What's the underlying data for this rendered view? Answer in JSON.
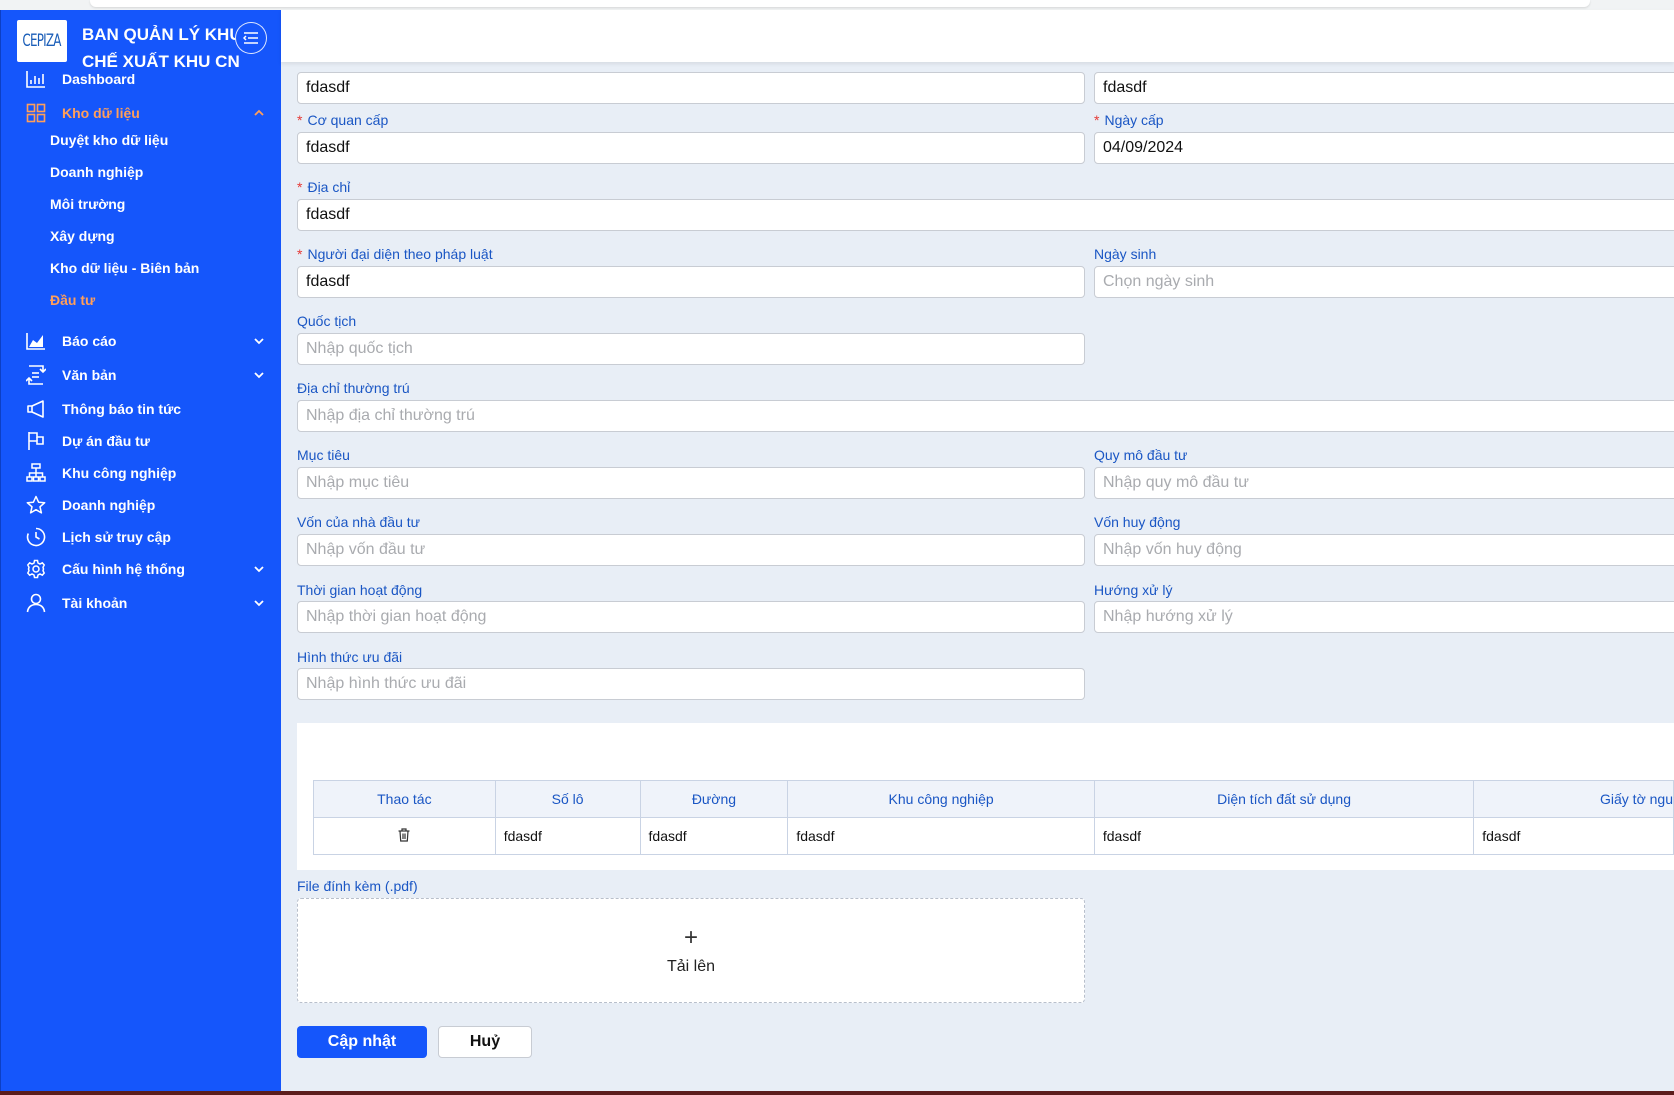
{
  "brand": {
    "logo_text": "CEPIZA",
    "line1": "BAN QUẢN LÝ KHU",
    "line2": "CHẾ XUẤT KHU CN"
  },
  "sidebar": {
    "items": [
      {
        "label": "Dashboard",
        "icon": "bar-chart-icon"
      },
      {
        "label": "Kho dữ liệu",
        "icon": "grid-icon",
        "active": true,
        "expanded": true
      },
      {
        "label": "Báo cáo",
        "icon": "area-chart-icon"
      },
      {
        "label": "Văn bản",
        "icon": "transfer-icon"
      },
      {
        "label": "Thông báo tin tức",
        "icon": "megaphone-icon"
      },
      {
        "label": "Dự án đầu tư",
        "icon": "flag-icon"
      },
      {
        "label": "Khu công nghiệp",
        "icon": "cluster-icon"
      },
      {
        "label": "Doanh nghiệp",
        "icon": "star-icon"
      },
      {
        "label": "Lịch sử truy cập",
        "icon": "clock-icon"
      },
      {
        "label": "Cấu hình hệ thống",
        "icon": "gear-icon"
      },
      {
        "label": "Tài khoản",
        "icon": "user-icon"
      }
    ],
    "subitems": [
      {
        "label": "Duyệt kho dữ liệu"
      },
      {
        "label": "Doanh nghiệp"
      },
      {
        "label": "Môi trường"
      },
      {
        "label": "Xây dựng"
      },
      {
        "label": "Kho dữ liệu - Biên bản"
      },
      {
        "label": "Đầu tư",
        "active": true
      }
    ]
  },
  "form": {
    "nha_dau_tu": {
      "value": "fdasdf"
    },
    "gcn": {
      "value": "fdasdf"
    },
    "co_quan_cap": {
      "label": "Cơ quan cấp",
      "value": "fdasdf"
    },
    "ngay_cap": {
      "label": "Ngày cấp",
      "value": "04/09/2024"
    },
    "dia_chi": {
      "label": "Địa chỉ",
      "value": "fdasdf"
    },
    "nguoi_dai_dien": {
      "label": "Người đại diện theo pháp luật",
      "value": "fdasdf"
    },
    "ngay_sinh": {
      "label": "Ngày sinh",
      "placeholder": "Chọn ngày sinh"
    },
    "quoc_tich": {
      "label": "Quốc tịch",
      "placeholder": "Nhập quốc tịch"
    },
    "dia_chi_thuong_tru": {
      "label": "Địa chỉ thường trú",
      "placeholder": "Nhập địa chỉ thường trú"
    },
    "muc_tieu": {
      "label": "Mục tiêu",
      "placeholder": "Nhập mục tiêu"
    },
    "quy_mo": {
      "label": "Quy mô đầu tư",
      "placeholder": "Nhập quy mô đầu tư"
    },
    "von_nha_dau_tu": {
      "label": "Vốn của nhà đầu tư",
      "placeholder": "Nhập vốn đầu tư"
    },
    "von_huy_dong": {
      "label": "Vốn huy động",
      "placeholder": "Nhập vốn huy động"
    },
    "thoi_gian": {
      "label": "Thời gian hoạt động",
      "placeholder": "Nhập thời gian hoạt động"
    },
    "huong_xu_ly": {
      "label": "Hướng xử lý",
      "placeholder": "Nhập hướng xử lý"
    },
    "hinh_thuc": {
      "label": "Hình thức ưu đãi",
      "placeholder": "Nhập hình thức ưu đãi"
    }
  },
  "table": {
    "headers": [
      "Thao tác",
      "Số lô",
      "Đường",
      "Khu công nghiệp",
      "Diện tích đất sử dụng",
      "Giấy tờ ngu"
    ],
    "rows": [
      {
        "action_icon": "trash-icon",
        "cells": [
          "fdasdf",
          "fdasdf",
          "fdasdf",
          "fdasdf",
          "fdasdf"
        ]
      }
    ]
  },
  "upload": {
    "label": "File đính kèm (.pdf)",
    "plus": "+",
    "button": "Tải lên"
  },
  "actions": {
    "submit": "Cập nhật",
    "cancel": "Huỷ"
  }
}
